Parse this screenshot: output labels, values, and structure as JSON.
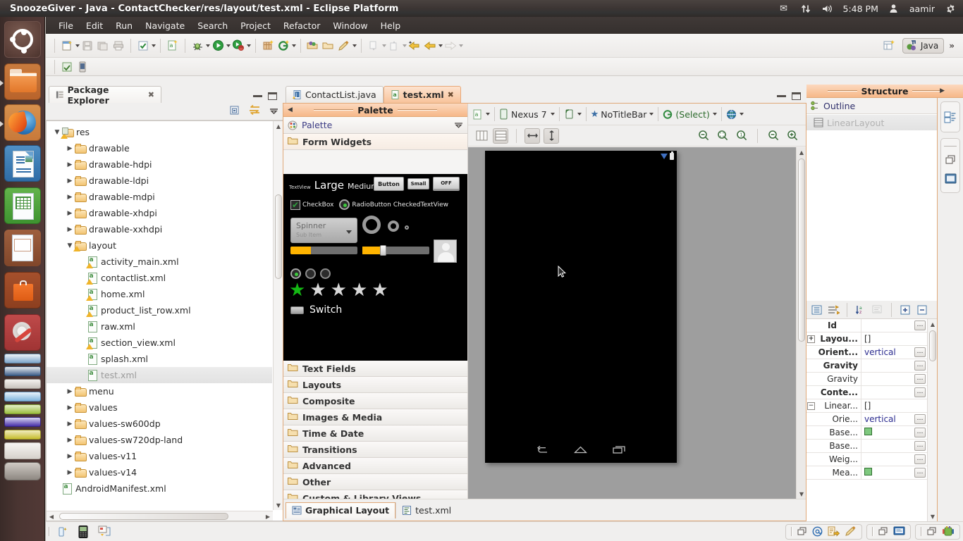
{
  "window": {
    "title": "SnoozeGiver - Java - ContactChecker/res/layout/test.xml - Eclipse Platform"
  },
  "tray": {
    "mail_icon": "envelope-icon",
    "network_icon": "network-updown-icon",
    "volume_icon": "volume-icon",
    "time": "5:48 PM",
    "user": "aamir",
    "gear_icon": "gear-icon"
  },
  "launcher": {
    "items": [
      {
        "name": "ubuntu-dash",
        "label": "Ubuntu Dash"
      },
      {
        "name": "files",
        "label": "Files"
      },
      {
        "name": "firefox",
        "label": "Firefox Web Browser"
      },
      {
        "name": "libreoffice-writer",
        "label": "LibreOffice Writer"
      },
      {
        "name": "libreoffice-calc",
        "label": "LibreOffice Calc"
      },
      {
        "name": "libreoffice-impress",
        "label": "LibreOffice Impress"
      },
      {
        "name": "ubuntu-software-center",
        "label": "Ubuntu Software Center"
      },
      {
        "name": "system-settings",
        "label": "System Settings"
      }
    ]
  },
  "menubar": {
    "items": [
      "File",
      "Edit",
      "Run",
      "Navigate",
      "Search",
      "Project",
      "Refactor",
      "Window",
      "Help"
    ]
  },
  "toolbar": {
    "groups": [
      [
        "new-wizard",
        "save",
        "save-all",
        "print"
      ],
      [
        "check-mark",
        "dropdown"
      ],
      [
        "android-new-xml"
      ],
      [
        "debug",
        "run",
        "run-android"
      ],
      [
        "new-android-project",
        "new-android-activity"
      ],
      [
        "open-type",
        "open-package",
        "new-annotation"
      ],
      [
        "previous-annotation",
        "next-annotation",
        "last-edit",
        "back",
        "forward"
      ]
    ],
    "perspective_label": "Java",
    "overflow_label": "»"
  },
  "package_explorer": {
    "tab_label": "Package Explorer",
    "view_buttons": [
      "collapse-all",
      "link-with-editor",
      "view-menu"
    ],
    "tree": [
      {
        "label": "res",
        "indent": 0,
        "twisty": "open",
        "icon": "res-folder-icon",
        "warn": true
      },
      {
        "label": "drawable",
        "indent": 1,
        "twisty": "closed",
        "icon": "folder-icon"
      },
      {
        "label": "drawable-hdpi",
        "indent": 1,
        "twisty": "closed",
        "icon": "folder-icon"
      },
      {
        "label": "drawable-ldpi",
        "indent": 1,
        "twisty": "closed",
        "icon": "folder-icon"
      },
      {
        "label": "drawable-mdpi",
        "indent": 1,
        "twisty": "closed",
        "icon": "folder-icon"
      },
      {
        "label": "drawable-xhdpi",
        "indent": 1,
        "twisty": "closed",
        "icon": "folder-icon"
      },
      {
        "label": "drawable-xxhdpi",
        "indent": 1,
        "twisty": "closed",
        "icon": "folder-icon"
      },
      {
        "label": "layout",
        "indent": 1,
        "twisty": "open",
        "icon": "folder-icon",
        "warn": true
      },
      {
        "label": "activity_main.xml",
        "indent": 2,
        "twisty": "none",
        "icon": "xml-icon",
        "warn": true
      },
      {
        "label": "contactlist.xml",
        "indent": 2,
        "twisty": "none",
        "icon": "xml-icon",
        "warn": true
      },
      {
        "label": "home.xml",
        "indent": 2,
        "twisty": "none",
        "icon": "xml-icon",
        "warn": true
      },
      {
        "label": "product_list_row.xml",
        "indent": 2,
        "twisty": "none",
        "icon": "xml-icon",
        "warn": true
      },
      {
        "label": "raw.xml",
        "indent": 2,
        "twisty": "none",
        "icon": "xml-icon"
      },
      {
        "label": "section_view.xml",
        "indent": 2,
        "twisty": "none",
        "icon": "xml-icon",
        "warn": true
      },
      {
        "label": "splash.xml",
        "indent": 2,
        "twisty": "none",
        "icon": "xml-icon"
      },
      {
        "label": "test.xml",
        "indent": 2,
        "twisty": "none",
        "icon": "xml-icon",
        "selected": true
      },
      {
        "label": "menu",
        "indent": 1,
        "twisty": "closed",
        "icon": "folder-icon"
      },
      {
        "label": "values",
        "indent": 1,
        "twisty": "closed",
        "icon": "folder-icon"
      },
      {
        "label": "values-sw600dp",
        "indent": 1,
        "twisty": "closed",
        "icon": "folder-icon"
      },
      {
        "label": "values-sw720dp-land",
        "indent": 1,
        "twisty": "closed",
        "icon": "folder-icon"
      },
      {
        "label": "values-v11",
        "indent": 1,
        "twisty": "closed",
        "icon": "folder-icon"
      },
      {
        "label": "values-v14",
        "indent": 1,
        "twisty": "closed",
        "icon": "folder-icon"
      },
      {
        "label": "AndroidManifest.xml",
        "indent": 0,
        "twisty": "none",
        "icon": "xml-icon"
      }
    ]
  },
  "editor": {
    "tabs": [
      {
        "label": "ContactList.java",
        "active": false,
        "icon": "java-file-icon",
        "closable": false
      },
      {
        "label": "test.xml",
        "active": true,
        "icon": "xml-file-icon",
        "closable": true
      }
    ],
    "bottom_tabs": [
      {
        "label": "Graphical Layout",
        "active": true,
        "icon": "graphical-layout-icon"
      },
      {
        "label": "test.xml",
        "active": false,
        "icon": "xml-source-icon"
      }
    ],
    "config_bar": {
      "config_icon": "layout-config-icon",
      "device": "Nexus 7",
      "orientation_icon": "orientation-icon",
      "theme": "NoTitleBar",
      "theme_icon": "theme-star-icon",
      "activity": "(Select)",
      "activity_icon": "activity-icon",
      "locale_icon": "globe-icon"
    },
    "view_buttons": [
      "show-outline",
      "show-properties",
      "fit-width",
      "fit-height",
      "zoom-out",
      "zoom-fit",
      "zoom-100",
      "zoom-minus",
      "zoom-plus"
    ]
  },
  "palette": {
    "header_title": "Palette",
    "menu_label": "Palette",
    "menu_icon": "palette-icon",
    "groups": [
      {
        "label": "Form Widgets",
        "open": true
      },
      {
        "label": "Text Fields",
        "open": false
      },
      {
        "label": "Layouts",
        "open": false
      },
      {
        "label": "Composite",
        "open": false
      },
      {
        "label": "Images & Media",
        "open": false
      },
      {
        "label": "Time & Date",
        "open": false
      },
      {
        "label": "Transitions",
        "open": false
      },
      {
        "label": "Advanced",
        "open": false
      },
      {
        "label": "Other",
        "open": false
      },
      {
        "label": "Custom & Library Views",
        "open": false
      }
    ],
    "form_widgets": {
      "textview": "TextView",
      "large": "Large",
      "medium": "Medium",
      "small": "Small",
      "button": "Button",
      "small_button": "Small",
      "toggle_button": "OFF",
      "checkbox": "CheckBox",
      "radiobutton": "RadioButton",
      "checked_textview": "CheckedTextView",
      "spinner": "Spinner",
      "spinner_subitem": "Sub Item",
      "switch_label": "Switch",
      "progress_fill_percent": 30,
      "seekbar_fill_percent": 30,
      "rating_stars_total": 5,
      "rating_stars_filled": 1
    }
  },
  "structure": {
    "header_title": "Structure",
    "tab_label": "Outline",
    "tree": [
      {
        "label": "LinearLayout",
        "selected": true,
        "icon": "linearlayout-icon"
      }
    ],
    "side_buttons": [
      "outline-view-icon",
      "restore-icon",
      "properties-view-icon"
    ],
    "properties_toolbar": [
      "show-categories-icon",
      "sort-alpha-icon",
      "sort-icon",
      "filter-icon",
      "expand-all-icon",
      "collapse-all-icon"
    ],
    "properties": [
      {
        "name": "Id",
        "value": "",
        "bold": true,
        "indent": 0,
        "expander": "none",
        "dots": true
      },
      {
        "name": "Layou...",
        "value": "[]",
        "bold": true,
        "indent": 0,
        "expander": "plus",
        "dots": false
      },
      {
        "name": "Orient...",
        "value": "vertical",
        "bold": true,
        "indent": 1,
        "expander": "none",
        "dots": true
      },
      {
        "name": "Gravity",
        "value": "",
        "bold": true,
        "indent": 1,
        "expander": "none",
        "dots": true
      },
      {
        "name": "Gravity",
        "value": "",
        "bold": false,
        "indent": 1,
        "expander": "none",
        "dots": true
      },
      {
        "name": "Conte...",
        "value": "",
        "bold": true,
        "indent": 1,
        "expander": "none",
        "dots": true
      },
      {
        "name": "Linear...",
        "value": "[]",
        "bold": false,
        "indent": 0,
        "expander": "minus",
        "dots": false
      },
      {
        "name": "Orie...",
        "value": "vertical",
        "bold": false,
        "indent": 2,
        "expander": "none",
        "dots": true
      },
      {
        "name": "Base...",
        "value": "",
        "bold": false,
        "indent": 2,
        "expander": "none",
        "dots": true,
        "swatch": true
      },
      {
        "name": "Base...",
        "value": "",
        "bold": false,
        "indent": 2,
        "expander": "none",
        "dots": true
      },
      {
        "name": "Weig...",
        "value": "",
        "bold": false,
        "indent": 2,
        "expander": "none",
        "dots": true
      },
      {
        "name": "Mea...",
        "value": "",
        "bold": false,
        "indent": 2,
        "expander": "none",
        "dots": true,
        "swatch": true
      }
    ]
  },
  "device_preview": {
    "status_icons": [
      "wifi-icon",
      "battery-icon"
    ],
    "nav_buttons": [
      "back-icon",
      "home-icon",
      "recents-icon"
    ]
  },
  "statusbar": {
    "left_icons": [
      "android-device-icon",
      "android-phone-icon",
      "android-logcat-icon"
    ],
    "right_groups": [
      [
        "restore-icon",
        "at-icon",
        "doc-export-icon",
        "pen-icon"
      ],
      [
        "restore-icon",
        "console-icon"
      ],
      [
        "restore-icon",
        "android-icon"
      ]
    ]
  },
  "colors": {
    "accent_orange": "#f6b889",
    "panel_bg": "#f0efee",
    "selection_gray": "#e6e6e6",
    "value_blue": "#2b2b8f"
  }
}
